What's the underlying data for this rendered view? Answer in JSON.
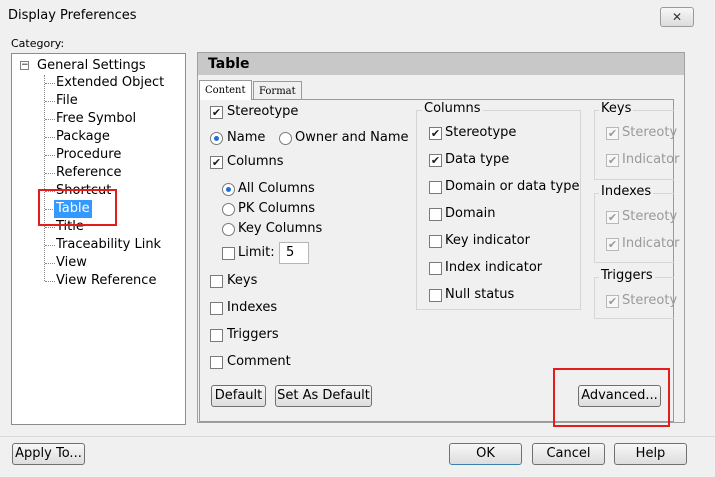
{
  "window": {
    "title": "Display Preferences",
    "close_glyph": "✕"
  },
  "category": {
    "label": "Category:",
    "root": "General Settings",
    "expander_glyph": "−",
    "items": [
      "Extended Object",
      "File",
      "Free Symbol",
      "Package",
      "Procedure",
      "Reference",
      "Shortcut",
      "Table",
      "Title",
      "Traceability Link",
      "View",
      "View Reference"
    ],
    "selected": "Table"
  },
  "panel": {
    "header": "Table",
    "tabs": [
      "Content",
      "Format"
    ],
    "active_tab": "Content",
    "content": {
      "stereotype": "Stereotype",
      "name_radio": "Name",
      "owner_name_radio": "Owner and Name",
      "columns": "Columns",
      "all_columns": "All Columns",
      "pk_columns": "PK Columns",
      "key_columns": "Key Columns",
      "limit_label": "Limit:",
      "limit_value": "5",
      "keys": "Keys",
      "indexes": "Indexes",
      "triggers": "Triggers",
      "comment": "Comment",
      "check_glyph": "✔"
    },
    "columns_group": {
      "title": "Columns",
      "items": [
        "Stereotype",
        "Data type",
        "Domain or data type",
        "Domain",
        "Key indicator",
        "Index indicator",
        "Null status"
      ]
    },
    "keys_group": {
      "title": "Keys",
      "items": [
        "Stereoty",
        "Indicator"
      ]
    },
    "indexes_group": {
      "title": "Indexes",
      "items": [
        "Stereoty",
        "Indicator"
      ]
    },
    "triggers_group": {
      "title": "Triggers",
      "items": [
        "Stereoty"
      ]
    },
    "buttons": {
      "default": "Default",
      "set_as_default": "Set As Default",
      "advanced": "Advanced..."
    }
  },
  "footer": {
    "apply_to": "Apply To...",
    "ok": "OK",
    "cancel": "Cancel",
    "help": "Help"
  },
  "colors": {
    "selection": "#3399ff",
    "highlight": "#e21d1d",
    "header_bg": "#c8c8c8"
  }
}
